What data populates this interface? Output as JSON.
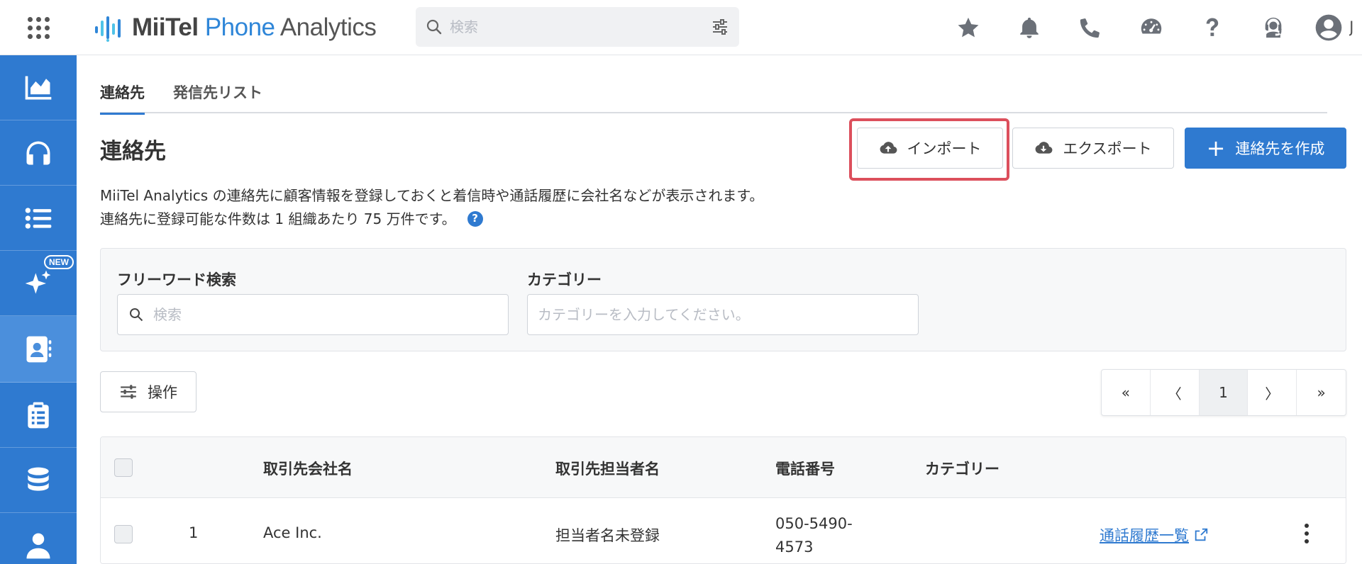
{
  "header": {
    "logo_mii": "MiiTel",
    "logo_phone": "Phone",
    "logo_analytics": "Analytics",
    "search_placeholder": "検索",
    "user_initial": "J"
  },
  "tabs": [
    {
      "label": "連絡先",
      "active": true
    },
    {
      "label": "発信先リスト",
      "active": false
    }
  ],
  "page": {
    "title": "連絡先",
    "description_line1": "MiiTel Analytics の連絡先に顧客情報を登録しておくと着信時や通話履歴に会社名などが表示されます。",
    "description_line2": "連絡先に登録可能な件数は 1 組織あたり 75 万件です。",
    "help_glyph": "?"
  },
  "actions": {
    "import_label": "インポート",
    "export_label": "エクスポート",
    "create_label": "連絡先を作成"
  },
  "sidebar": {
    "new_badge": "NEW"
  },
  "filters": {
    "freeword_label": "フリーワード検索",
    "freeword_placeholder": "検索",
    "category_label": "カテゴリー",
    "category_placeholder": "カテゴリーを入力してください。"
  },
  "toolbar": {
    "operations_label": "操作"
  },
  "pagination": {
    "first": "«",
    "prev": "〈",
    "current": "1",
    "next": "〉",
    "last": "»"
  },
  "table": {
    "headers": {
      "company": "取引先会社名",
      "contact": "取引先担当者名",
      "phone": "電話番号",
      "category": "カテゴリー"
    },
    "rows": [
      {
        "index": "1",
        "company": "Ace Inc.",
        "contact": "担当者名未登録",
        "phone_line1": "050-5490-",
        "phone_line2": "4573",
        "category": "",
        "history_link": "通話履歴一覧"
      }
    ]
  },
  "colors": {
    "primary": "#2f7ad0",
    "highlight": "#dc4f5c"
  }
}
